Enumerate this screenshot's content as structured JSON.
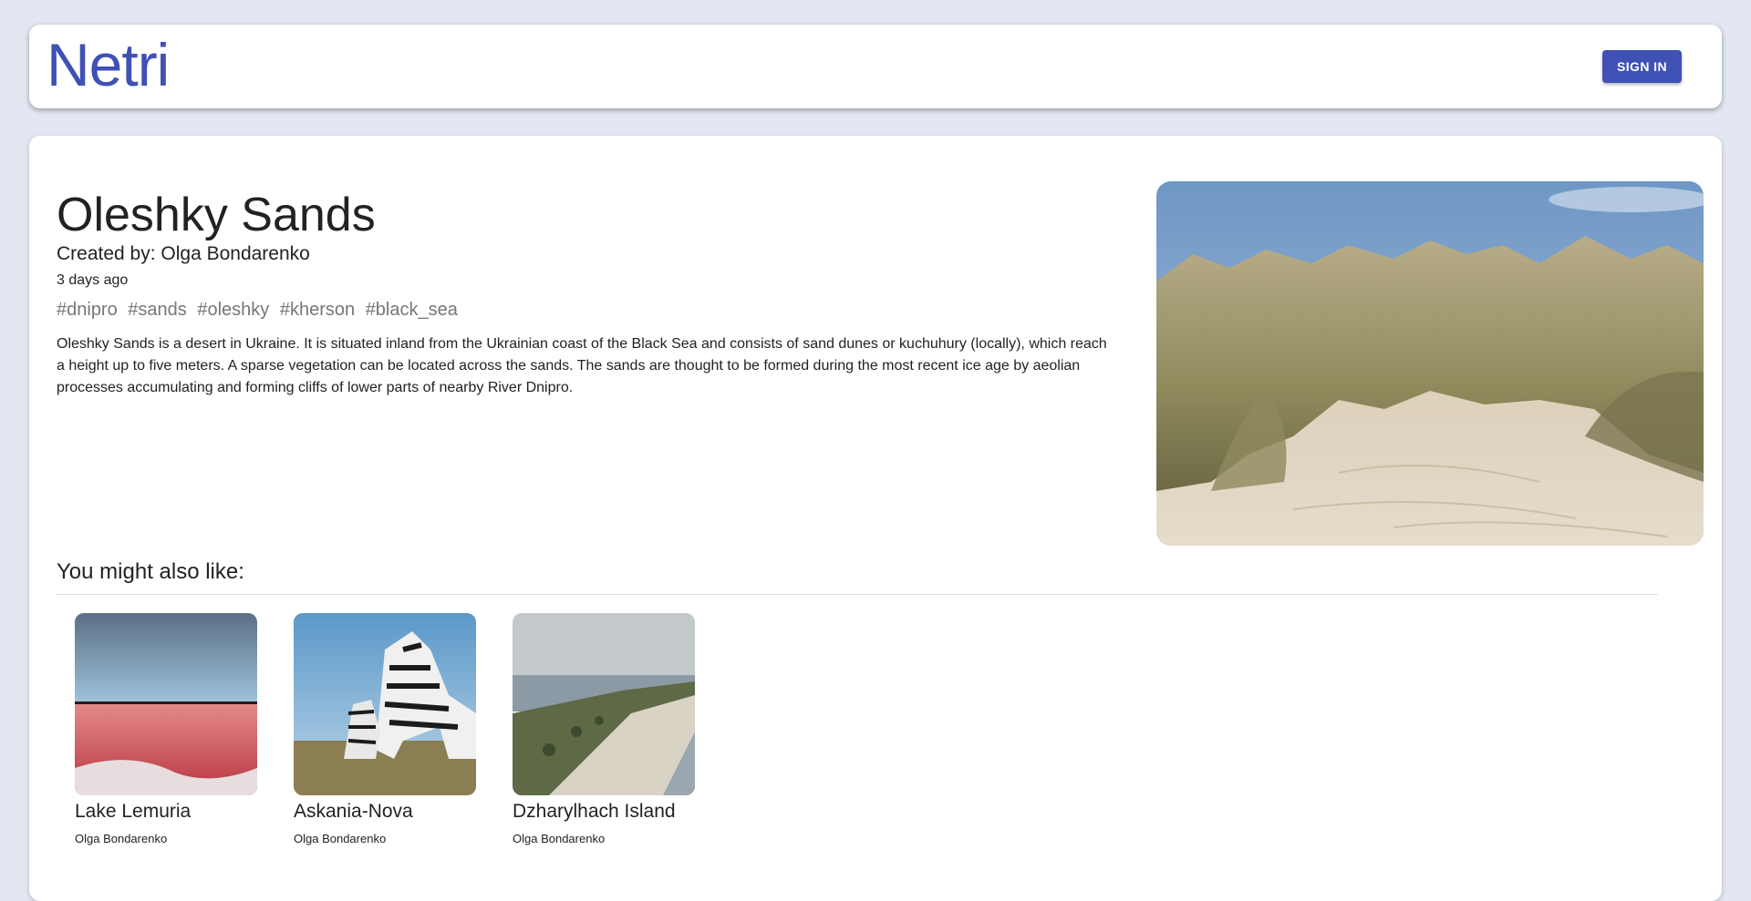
{
  "header": {
    "logo": "Netri",
    "signin_label": "SIGN IN",
    "accent_color": "#3f51b5"
  },
  "place": {
    "title": "Oleshky Sands",
    "created_by": "Created by: Olga Bondarenko",
    "time": "3 days ago",
    "tags": [
      "#dnipro",
      "#sands",
      "#oleshky",
      "#kherson",
      "#black_sea"
    ],
    "description": "Oleshky Sands is a desert in Ukraine. It is situated inland from the Ukrainian coast of the Black Sea and consists of sand dunes or kuchuhury (locally), which reach a height up to five meters. A sparse vegetation can be located across the sands. The sands are thought to be formed during the most recent ice age by aeolian processes accumulating and forming cliffs of lower parts of nearby River Dnipro."
  },
  "recommendations": {
    "heading": "You might also like:",
    "items": [
      {
        "title": "Lake Lemuria",
        "author": "Olga Bondarenko"
      },
      {
        "title": "Askania-Nova",
        "author": "Olga Bondarenko"
      },
      {
        "title": "Dzharylhach Island",
        "author": "Olga Bondarenko"
      }
    ]
  }
}
